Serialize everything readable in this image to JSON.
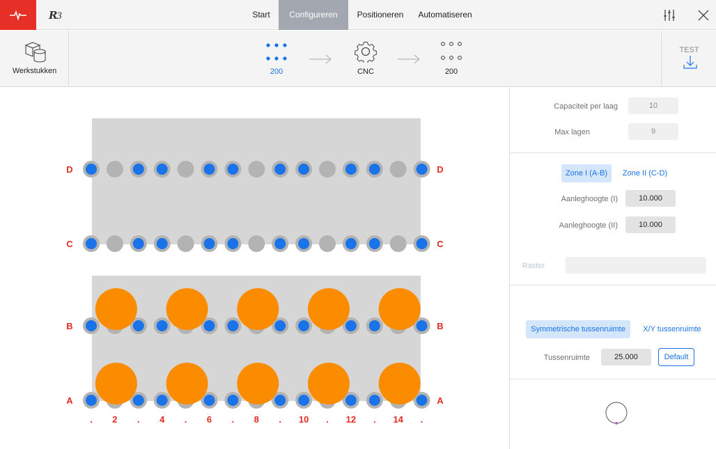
{
  "nav": {
    "tabs": [
      {
        "label": "Start",
        "active": false
      },
      {
        "label": "Configureren",
        "active": true
      },
      {
        "label": "Positioneren",
        "active": false
      },
      {
        "label": "Automatiseren",
        "active": false
      }
    ]
  },
  "workflow": {
    "workpieces_label": "Werkstukken",
    "steps": [
      {
        "label": "200",
        "icon": "grid-dots-filled-icon"
      },
      {
        "label": "CNC",
        "icon": "gear-icon"
      },
      {
        "label": "200",
        "icon": "grid-dots-outline-icon"
      }
    ],
    "test_label": "TEST"
  },
  "canvas": {
    "row_labels": [
      "D",
      "C",
      "B",
      "A"
    ],
    "column_labels": [
      ".",
      "2",
      ".",
      "4",
      ".",
      "6",
      ".",
      "8",
      ".",
      "10",
      ".",
      "12",
      ".",
      "14",
      "."
    ],
    "rows": {
      "D": [
        1,
        0,
        1,
        1,
        0,
        1,
        1,
        0,
        1,
        1,
        0,
        1,
        1,
        0,
        1
      ],
      "C": [
        1,
        0,
        1,
        1,
        0,
        1,
        1,
        0,
        1,
        1,
        0,
        1,
        1,
        0,
        1
      ],
      "B": [
        1,
        0,
        1,
        1,
        0,
        1,
        1,
        0,
        1,
        1,
        0,
        1,
        1,
        0,
        1
      ],
      "A": [
        1,
        0,
        1,
        1,
        0,
        1,
        1,
        0,
        1,
        1,
        0,
        1,
        1,
        0,
        1
      ]
    },
    "workpiece_count": 10,
    "colors": {
      "plate": "#d6d6d6",
      "pin_inactive": "#b3b3b3",
      "pin_active": "#1a73e8",
      "workpiece": "#fb8c00",
      "label": "#e52b23"
    }
  },
  "panel": {
    "capacity_label": "Capaciteit per laag",
    "capacity_value": "10",
    "max_layers_label": "Max lagen",
    "max_layers_value": "9",
    "zone1_label": "Zone I (A-B)",
    "zone2_label": "Zone II (C-D)",
    "contact_height_1_label": "Aanleghoogte (I)",
    "contact_height_1_value": "10.000",
    "contact_height_2_label": "Aanleghoogte (II)",
    "contact_height_2_value": "10.000",
    "raster_label": "Raster",
    "raster_value": "",
    "symmetric_label": "Symmetrische tussenruimte",
    "xy_label": "X/Y tussenruimte",
    "spacing_label": "Tussenruimte",
    "spacing_value": "25.000",
    "default_label": "Default"
  },
  "colors": {
    "accent": "#1a73e8",
    "brand_red": "#e63027",
    "active_tab": "#a3a7af"
  }
}
